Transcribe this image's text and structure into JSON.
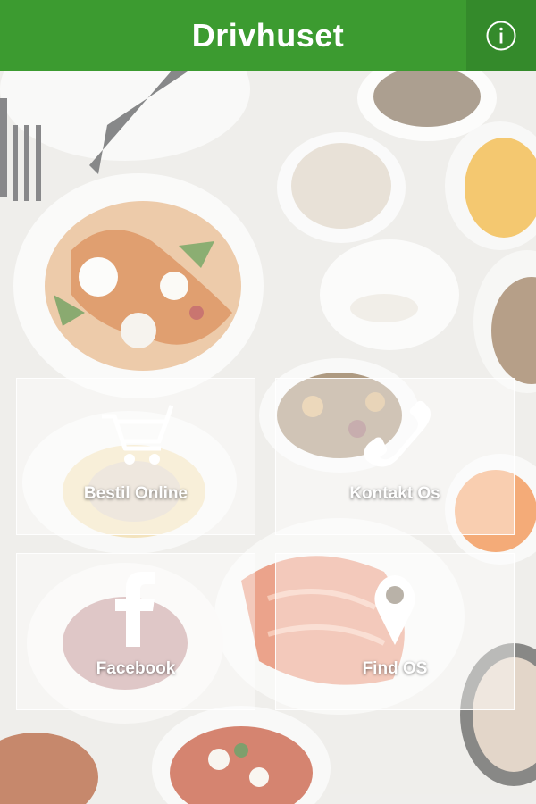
{
  "header": {
    "title": "Drivhuset",
    "info_icon": "info-circle-icon",
    "background_color": "#3c9b30",
    "info_background_color": "#348a2b"
  },
  "tiles": [
    {
      "label": "Bestil Online",
      "icon": "shopping-cart-icon"
    },
    {
      "label": "Kontakt Os",
      "icon": "phone-icon"
    },
    {
      "label": "Facebook",
      "icon": "facebook-icon"
    },
    {
      "label": "Find OS",
      "icon": "map-pin-icon"
    }
  ],
  "background": {
    "description_icon": "food-table-background"
  }
}
